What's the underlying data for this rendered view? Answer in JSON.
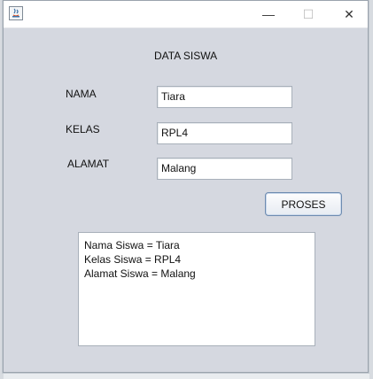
{
  "window": {
    "title": "",
    "controls": {
      "minimize": "—",
      "maximize": "☐",
      "close": "✕"
    },
    "icon": "java-app-icon"
  },
  "form": {
    "heading": "DATA SISWA",
    "fields": [
      {
        "label": "NAMA",
        "value": "Tiara"
      },
      {
        "label": "KELAS",
        "value": "RPL4"
      },
      {
        "label": "ALAMAT",
        "value": "Malang"
      }
    ],
    "submit_label": "PROSES"
  },
  "output": {
    "lines": [
      "Nama Siswa = Tiara",
      "Kelas Siswa = RPL4",
      "Alamat Siswa = Malang"
    ]
  }
}
